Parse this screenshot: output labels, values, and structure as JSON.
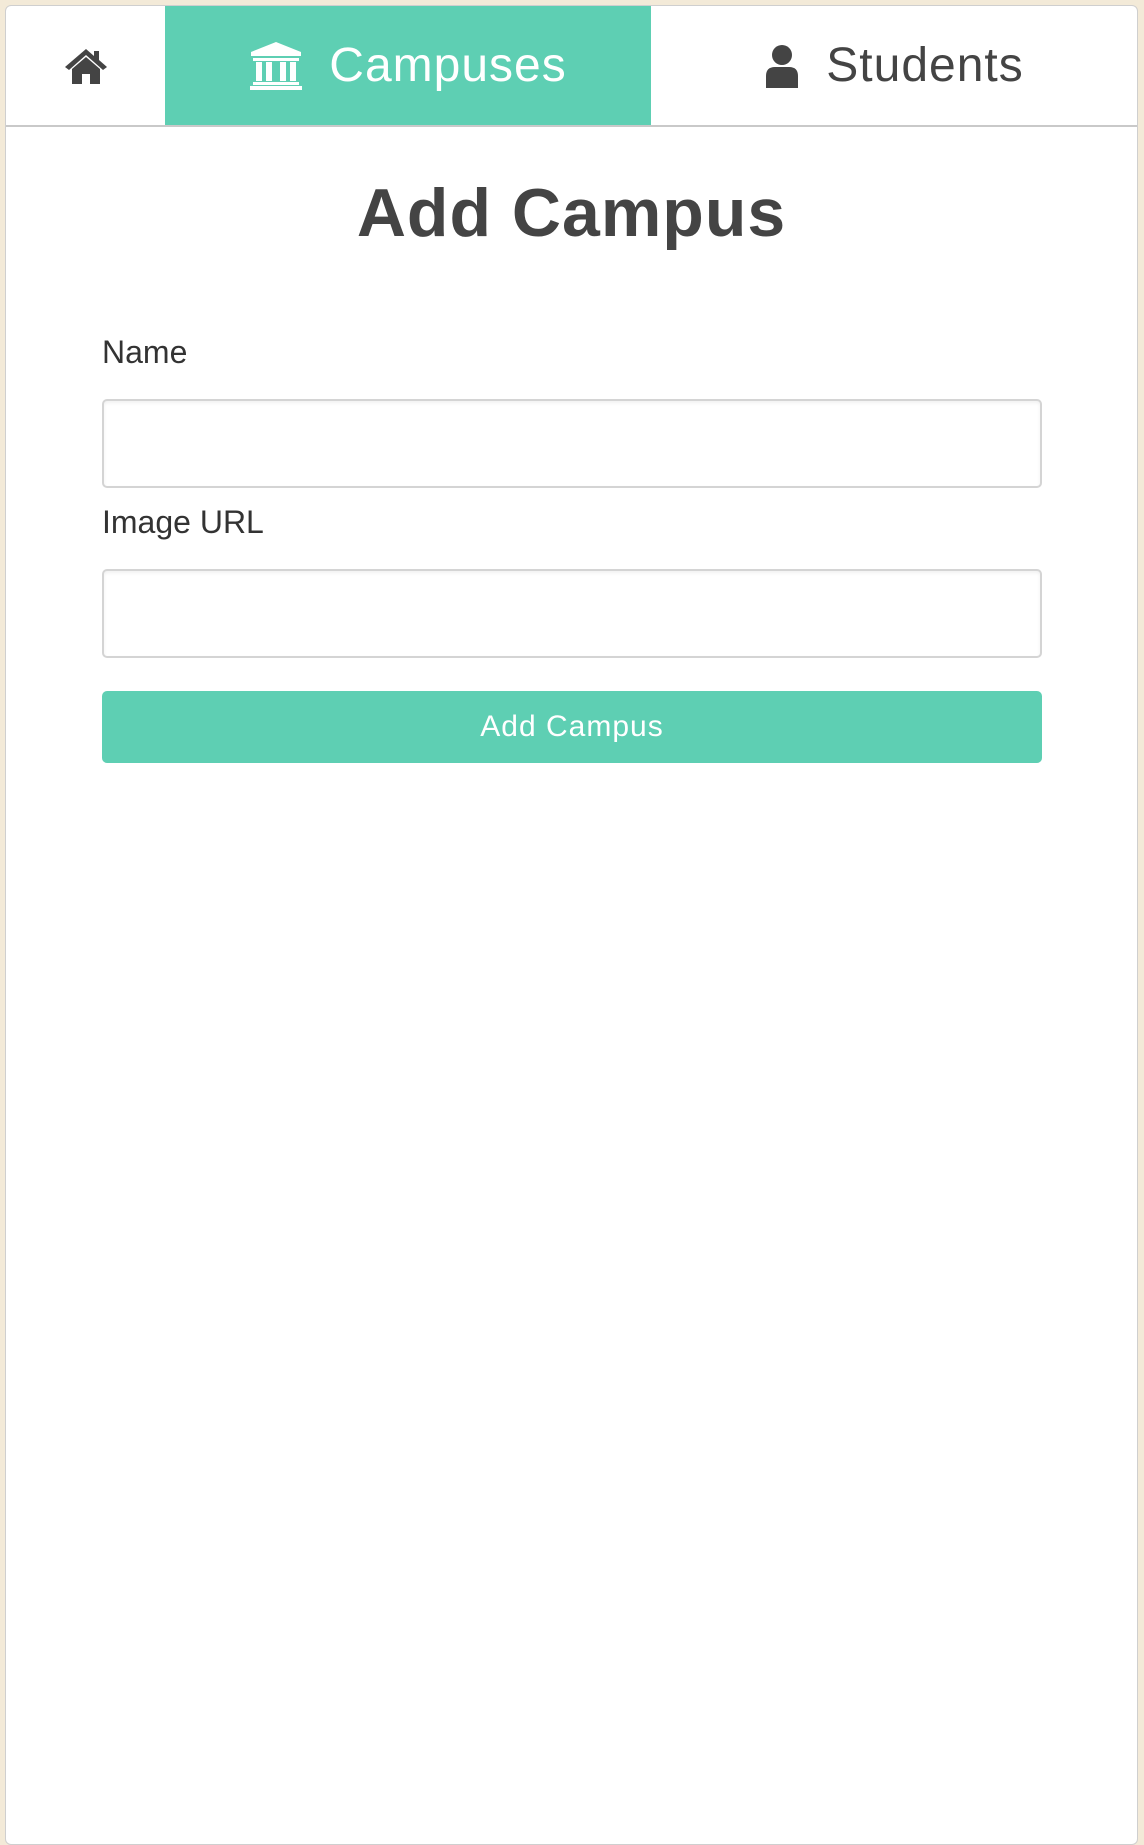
{
  "colors": {
    "accent": "#5ecfb3",
    "text": "#444444",
    "background": "#ffffff"
  },
  "navbar": {
    "home": {
      "icon": "home-icon"
    },
    "campuses": {
      "icon": "university-icon",
      "label": "Campuses",
      "active": true
    },
    "students": {
      "icon": "user-icon",
      "label": "Students",
      "active": false
    }
  },
  "form": {
    "title": "Add Campus",
    "name_label": "Name",
    "name_value": "",
    "image_label": "Image URL",
    "image_value": "",
    "submit_label": "Add Campus"
  }
}
